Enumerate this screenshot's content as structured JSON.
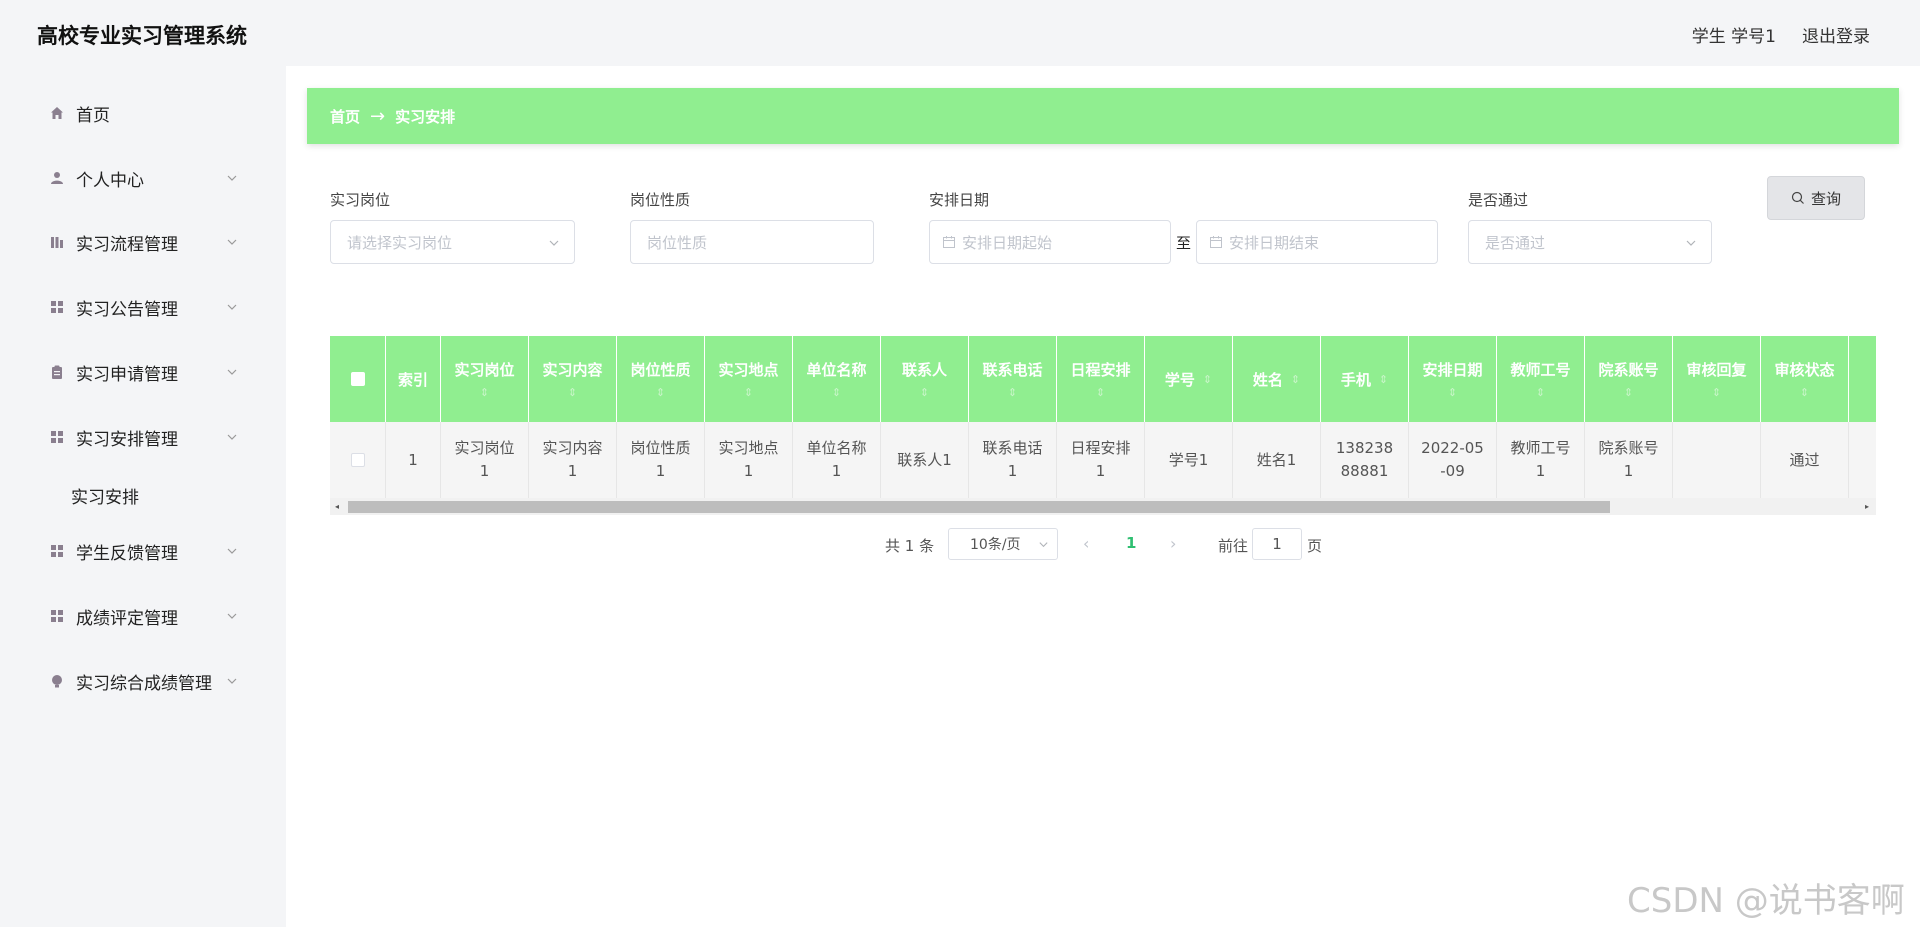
{
  "app": {
    "title": "高校专业实习管理系统"
  },
  "user": {
    "name": "学生 学号1",
    "logout": "退出登录"
  },
  "sidebar": {
    "items": [
      {
        "label": "首页",
        "icon": "home-icon"
      },
      {
        "label": "个人中心",
        "icon": "user-icon"
      },
      {
        "label": "实习流程管理",
        "icon": "chart-icon"
      },
      {
        "label": "实习公告管理",
        "icon": "grid-icon"
      },
      {
        "label": "实习申请管理",
        "icon": "clipboard-icon"
      },
      {
        "label": "实习安排管理",
        "icon": "grid-icon"
      },
      {
        "label": "学生反馈管理",
        "icon": "grid-icon"
      },
      {
        "label": "成绩评定管理",
        "icon": "grid-icon"
      },
      {
        "label": "实习综合成绩管理",
        "icon": "bulb-icon"
      }
    ],
    "sub_item": "实习安排"
  },
  "breadcrumb": {
    "home": "首页",
    "arrow": "→",
    "current": "实习安排"
  },
  "search": {
    "position_label": "实习岗位",
    "position_placeholder": "请选择实习岗位",
    "nature_label": "岗位性质",
    "nature_placeholder": "岗位性质",
    "date_label": "安排日期",
    "date_start_placeholder": "安排日期起始",
    "date_to": "至",
    "date_end_placeholder": "安排日期结束",
    "pass_label": "是否通过",
    "pass_placeholder": "是否通过",
    "query_button": "查询"
  },
  "table": {
    "columns": [
      "索引",
      "实习岗位",
      "实习内容",
      "岗位性质",
      "实习地点",
      "单位名称",
      "联系人",
      "联系电话",
      "日程安排",
      "学号",
      "姓名",
      "手机",
      "安排日期",
      "教师工号",
      "院系账号",
      "审核回复",
      "审核状态"
    ],
    "rows": [
      [
        "1",
        "实习岗位1",
        "实习内容1",
        "岗位性质1",
        "实习地点1",
        "单位名称1",
        "联系人1",
        "联系电话1",
        "日程安排1",
        "学号1",
        "姓名1",
        "13823888881",
        "2022-05-09",
        "教师工号1",
        "院系账号1",
        "",
        "通过"
      ]
    ]
  },
  "pagination": {
    "total": "共 1 条",
    "page_size": "10条/页",
    "current_page": "1",
    "goto_label": "前往",
    "goto_value": "1",
    "page_unit": "页"
  },
  "watermark": "CSDN @说书客啊",
  "colors": {
    "accent": "#90ee90",
    "active_page": "#2fbf71"
  }
}
